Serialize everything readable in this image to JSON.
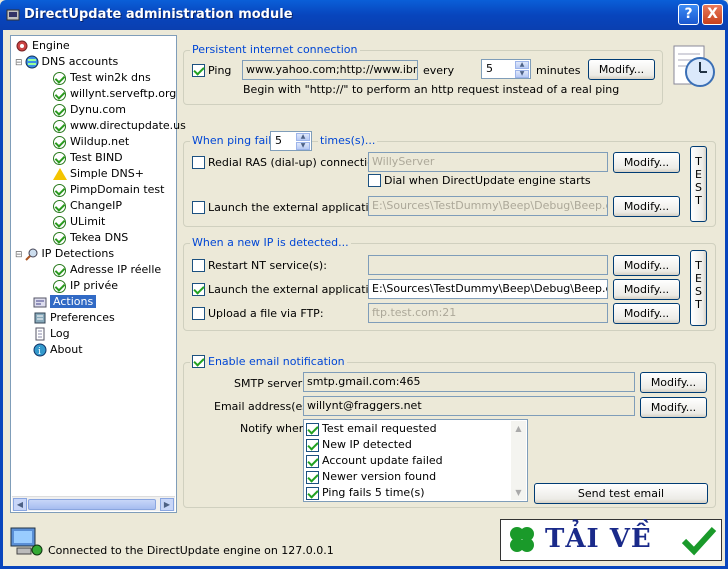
{
  "window": {
    "title": "DirectUpdate administration module",
    "help_label": "?",
    "close_label": "X"
  },
  "tree": {
    "items": [
      {
        "label": "Engine"
      },
      {
        "label": "DNS accounts"
      },
      {
        "label": "Test win2k dns"
      },
      {
        "label": "willynt.serveftp.org"
      },
      {
        "label": "Dynu.com"
      },
      {
        "label": "www.directupdate.us"
      },
      {
        "label": "Wildup.net"
      },
      {
        "label": "Test BIND"
      },
      {
        "label": "Simple DNS+"
      },
      {
        "label": "PimpDomain test"
      },
      {
        "label": "ChangeIP"
      },
      {
        "label": "ULimit"
      },
      {
        "label": "Tekea DNS"
      },
      {
        "label": "IP Detections"
      },
      {
        "label": "Adresse IP réelle"
      },
      {
        "label": "IP privée"
      },
      {
        "label": "Actions"
      },
      {
        "label": "Preferences"
      },
      {
        "label": "Log"
      },
      {
        "label": "About"
      }
    ]
  },
  "persistent": {
    "title": "Persistent internet connection",
    "ping_label": "Ping",
    "ping_checked": true,
    "ping_hosts": "www.yahoo.com;http://www.ibm.cc",
    "every_label": "every",
    "interval": "5",
    "minutes_label": "minutes",
    "modify": "Modify...",
    "hint": "Begin with \"http://\" to perform an http request instead of a real ping"
  },
  "ping_fails": {
    "title_prefix": "When ping fails",
    "count": "5",
    "title_suffix": "times(s)...",
    "redial_label": "Redial RAS (dial-up) connection:",
    "redial_value": "WillyServer",
    "dial_label": "Dial when DirectUpdate engine starts",
    "launch_label": "Launch the external application:",
    "launch_value": "E:\\Sources\\TestDummy\\Beep\\Debug\\Beep.exe",
    "modify": "Modify...",
    "test": [
      "T",
      "E",
      "S",
      "T"
    ]
  },
  "new_ip": {
    "title": "When a new IP is detected...",
    "restart_label": "Restart NT service(s):",
    "restart_value": "",
    "launch_label": "Launch the external application:",
    "launch_value": "E:\\Sources\\TestDummy\\Beep\\Debug\\Beep.exe",
    "upload_label": "Upload a file via FTP:",
    "upload_value": "ftp.test.com:21",
    "modify": "Modify...",
    "test": [
      "T",
      "E",
      "S",
      "T"
    ]
  },
  "email": {
    "enable_label": "Enable email notification",
    "smtp_label": "SMTP server:",
    "smtp_value": "smtp.gmail.com:465",
    "address_label": "Email address(es):",
    "address_value": "willynt@fraggers.net",
    "notify_label": "Notify when:",
    "modify": "Modify...",
    "notify_items": [
      {
        "label": "Test email requested"
      },
      {
        "label": "New IP detected"
      },
      {
        "label": "Account update failed"
      },
      {
        "label": "Newer version found"
      },
      {
        "label": "Ping fails 5 time(s)"
      }
    ],
    "send_test": "Send test email"
  },
  "status": {
    "text": "Connected to the DirectUpdate engine on 127.0.0.1"
  },
  "banner": {
    "text": "TẢI VỀ"
  },
  "colors": {
    "accent": "#0046d5",
    "title_bar": "#0845bd",
    "selection": "#316ac5",
    "check_green": "#21a121"
  }
}
